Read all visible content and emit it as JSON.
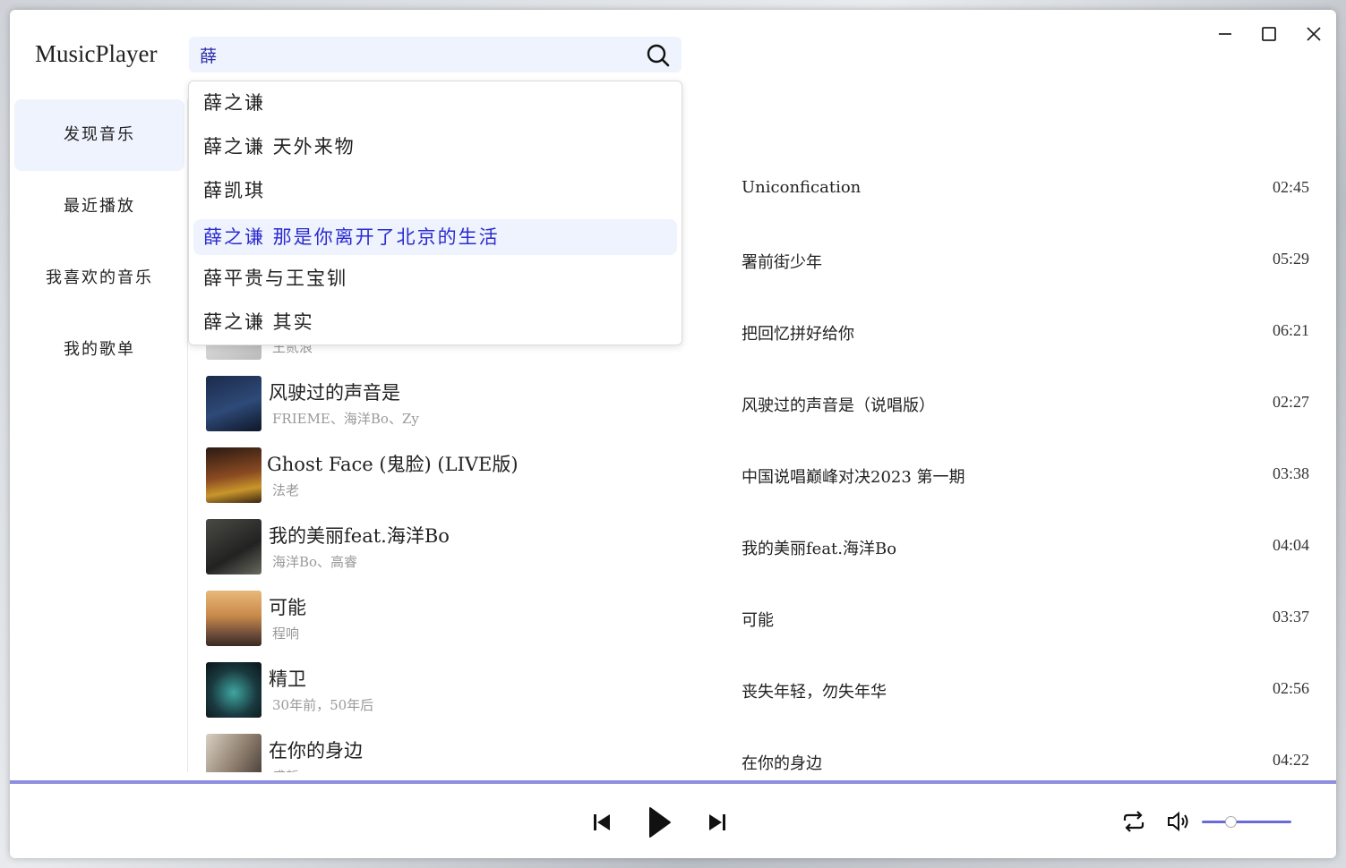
{
  "app": {
    "title": "MusicPlayer"
  },
  "search": {
    "value": "薛"
  },
  "sidebar": {
    "items": [
      {
        "label": "发现音乐",
        "active": true
      },
      {
        "label": "最近播放",
        "active": false
      },
      {
        "label": "我喜欢的音乐",
        "active": false
      },
      {
        "label": "我的歌单",
        "active": false
      }
    ]
  },
  "suggestions": [
    {
      "text": "薛之谦"
    },
    {
      "text": "薛之谦 天外来物"
    },
    {
      "text": "薛凯琪"
    },
    {
      "text": "薛之谦 那是你离开了北京的生活",
      "highlighted": true
    },
    {
      "text": "薛平贵与王宝钏"
    },
    {
      "text": "薛之谦 其实"
    }
  ],
  "songs": [
    {
      "title": "",
      "artist": "",
      "album": "Uniconfication",
      "duration": "02:45"
    },
    {
      "title": "",
      "artist": "",
      "album": "署前街少年",
      "duration": "05:29"
    },
    {
      "title": "",
      "artist": "王贰浪",
      "album": "把回忆拼好给你",
      "duration": "06:21"
    },
    {
      "title": "风驶过的声音是",
      "artist": "FRIEME、海洋Bo、Zy",
      "album": "风驶过的声音是（说唱版）",
      "duration": "02:27"
    },
    {
      "title": "Ghost Face (鬼脸) (LIVE版)",
      "artist": "法老",
      "album": "中国说唱巅峰对决2023 第一期",
      "duration": "03:38"
    },
    {
      "title": "我的美丽feat.海洋Bo",
      "artist": "海洋Bo、高睿",
      "album": "我的美丽feat.海洋Bo",
      "duration": "04:04"
    },
    {
      "title": "可能",
      "artist": "程响",
      "album": "可能",
      "duration": "03:37"
    },
    {
      "title": "精卫",
      "artist": "30年前，50年后",
      "album": "丧失年轻，勿失年华",
      "duration": "02:56"
    },
    {
      "title": "在你的身边",
      "artist": "盛哲",
      "album": "在你的身边",
      "duration": "04:22"
    }
  ],
  "player": {
    "progress": 1.0,
    "volume": 0.33,
    "icons": [
      "prev-icon",
      "play-icon",
      "next-icon",
      "repeat-icon",
      "volume-icon"
    ]
  },
  "colors": {
    "accent": "#6b6bd8",
    "active_bg": "#eef3fe",
    "highlight_text": "#2b2bd0"
  }
}
